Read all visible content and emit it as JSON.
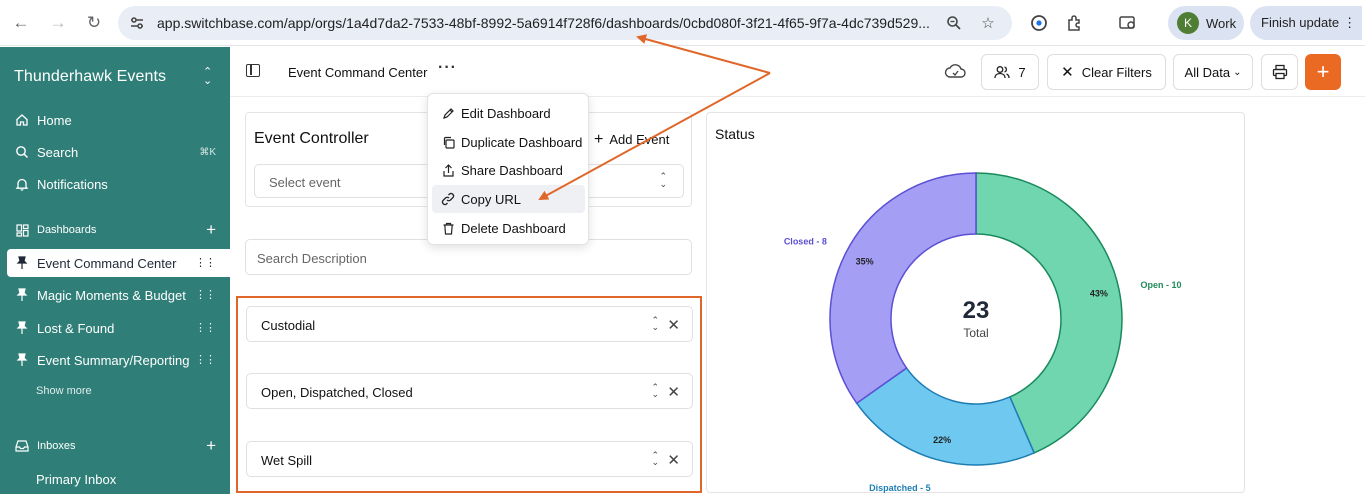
{
  "browser": {
    "url": "app.switchbase.com/app/orgs/1a4d7da2-7533-48bf-8992-5a6914f728f6/dashboards/0cbd080f-3f21-4f65-9f7a-4dc739d529...",
    "profile_initial": "K",
    "profile_label": "Work",
    "finish_update_label": "Finish update"
  },
  "sidebar": {
    "workspace_name": "Thunderhawk Events",
    "nav": [
      {
        "label": "Home",
        "icon": "home-icon"
      },
      {
        "label": "Search",
        "icon": "search-icon",
        "shortcut": "⌘K"
      },
      {
        "label": "Notifications",
        "icon": "bell-icon"
      }
    ],
    "dashboards_section": "Dashboards",
    "dashboards": [
      {
        "label": "Event Command Center",
        "active": true
      },
      {
        "label": "Magic Moments & Budget"
      },
      {
        "label": "Lost & Found"
      },
      {
        "label": "Event Summary/Reporting"
      }
    ],
    "show_more": "Show more",
    "inboxes_section": "Inboxes",
    "inboxes": [
      {
        "label": "Primary Inbox"
      }
    ]
  },
  "toolbar": {
    "title": "Event Command Center",
    "users_count": "7",
    "clear_filters": "Clear Filters",
    "data_select": "All Data"
  },
  "menu": {
    "items": [
      {
        "label": "Edit Dashboard",
        "icon": "edit-icon"
      },
      {
        "label": "Duplicate Dashboard",
        "icon": "duplicate-icon"
      },
      {
        "label": "Share Dashboard",
        "icon": "share-icon"
      },
      {
        "label": "Copy URL",
        "icon": "link-icon",
        "highlighted": true
      },
      {
        "label": "Delete Dashboard",
        "icon": "trash-icon"
      }
    ]
  },
  "event_controller": {
    "title": "Event Controller",
    "add_event": "Add Event",
    "select_placeholder": "Select event",
    "search_placeholder": "Search Description",
    "filters": [
      "Custodial",
      "Open, Dispatched, Closed",
      "Wet Spill"
    ]
  },
  "status_panel": {
    "title": "Status",
    "total_value": "23",
    "total_label": "Total"
  },
  "colors": {
    "sidebar": "#2f7f78",
    "accent_orange": "#ea6a23",
    "open": "#6fd6b0",
    "dispatched": "#6ec8ef",
    "closed": "#a59ef5"
  },
  "chart_data": {
    "type": "pie",
    "title": "Status",
    "center_value": 23,
    "center_label": "Total",
    "categories": [
      "Open",
      "Dispatched",
      "Closed"
    ],
    "values": [
      10,
      5,
      8
    ],
    "slice_labels": [
      "Open - 10",
      "Dispatched - 5",
      "Closed - 8"
    ],
    "percent_labels": [
      "43%",
      "22%",
      "35%"
    ],
    "colors": [
      "#6fd6b0",
      "#6ec8ef",
      "#a59ef5"
    ],
    "stroke_colors": [
      "#1a8a5e",
      "#1d7db3",
      "#5b4fd4"
    ],
    "label_colors": [
      "#1f8a5a",
      "#1e7fb5",
      "#5a4fd0"
    ]
  }
}
